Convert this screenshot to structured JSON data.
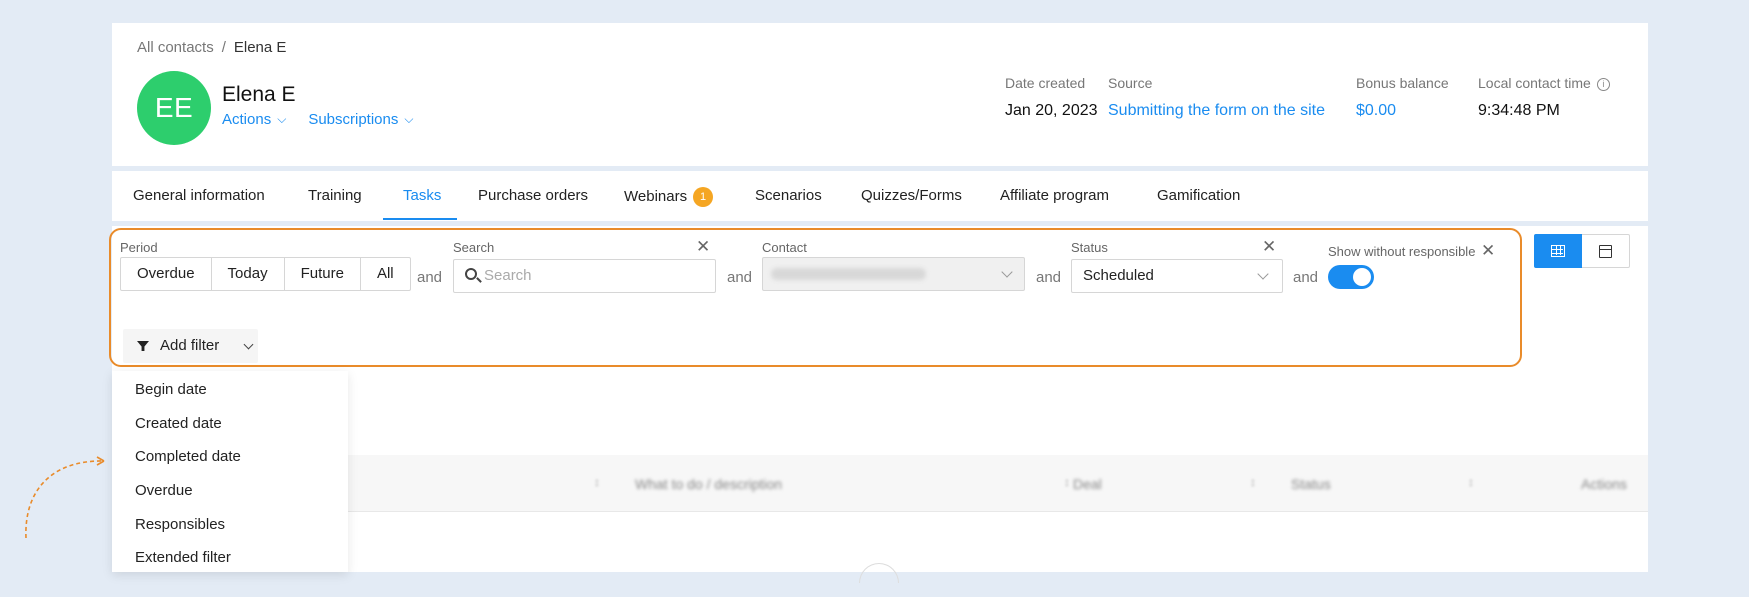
{
  "breadcrumb": {
    "parent": "All contacts",
    "separator": "/",
    "current": "Elena E"
  },
  "contact": {
    "initials": "EE",
    "name": "Elena E",
    "avatar_color": "#2dce6d",
    "actions_label": "Actions",
    "subscriptions_label": "Subscriptions"
  },
  "meta": {
    "date_created": {
      "label": "Date created",
      "value": "Jan 20, 2023"
    },
    "source": {
      "label": "Source",
      "value": "Submitting the form on the site"
    },
    "bonus_balance": {
      "label": "Bonus balance",
      "value": "$0.00"
    },
    "local_time": {
      "label": "Local contact time",
      "value": "9:34:48 PM"
    }
  },
  "tabs": [
    {
      "label": "General information"
    },
    {
      "label": "Training"
    },
    {
      "label": "Tasks",
      "active": true
    },
    {
      "label": "Purchase orders"
    },
    {
      "label": "Webinars",
      "badge": "1"
    },
    {
      "label": "Scenarios"
    },
    {
      "label": "Quizzes/Forms"
    },
    {
      "label": "Affiliate program"
    },
    {
      "label": "Gamification"
    }
  ],
  "filters": {
    "connector": "and",
    "period": {
      "label": "Period",
      "options": [
        "Overdue",
        "Today",
        "Future",
        "All"
      ]
    },
    "search": {
      "label": "Search",
      "placeholder": "Search"
    },
    "contact": {
      "label": "Contact"
    },
    "status": {
      "label": "Status",
      "value": "Scheduled"
    },
    "show_without_responsible": {
      "label": "Show without responsible",
      "enabled": true
    },
    "add_filter_label": "Add filter",
    "add_filter_menu": [
      "Begin date",
      "Created date",
      "Completed date",
      "Overdue",
      "Responsibles",
      "Extended filter"
    ]
  },
  "table": {
    "columns": [
      "What to do / description",
      "Deal",
      "Status",
      "Actions"
    ]
  },
  "colors": {
    "accent": "#1a8cf0",
    "highlight": "#e98b2a",
    "badge": "#f5a623",
    "background": "#e3ebf5"
  },
  "icons": [
    "chevron-down-icon",
    "info-icon",
    "close-icon",
    "search-icon",
    "funnel-icon",
    "grid-view-icon",
    "calendar-icon"
  ]
}
